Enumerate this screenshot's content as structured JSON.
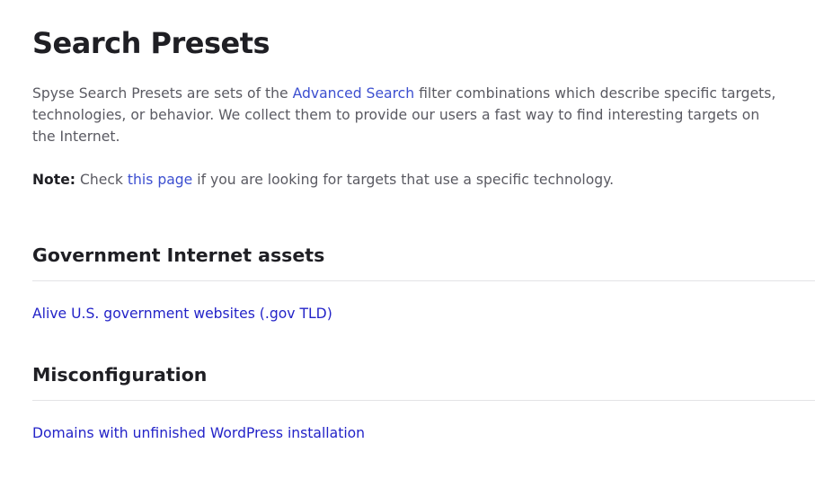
{
  "page": {
    "title": "Search Presets"
  },
  "intro": {
    "text_before_link": "Spyse Search Presets are sets of the ",
    "link_label": "Advanced Search",
    "text_after_link": " filter combinations which describe specific targets, technologies, or behavior. We collect them to provide our users a fast way to find interesting targets on the Internet."
  },
  "note": {
    "label": "Note:",
    "text_before_link": " Check ",
    "link_label": "this page",
    "text_after_link": " if you are looking for targets that use a specific technology."
  },
  "sections": [
    {
      "heading": "Government Internet assets",
      "presets": [
        {
          "label": "Alive U.S. government websites (.gov TLD)"
        }
      ]
    },
    {
      "heading": "Misconfiguration",
      "presets": [
        {
          "label": "Domains with unfinished WordPress installation"
        }
      ]
    }
  ],
  "colors": {
    "heading": "#1f1f24",
    "body_text": "#5a5a62",
    "inline_link": "#3c4fd0",
    "preset_link": "#2323c8",
    "divider": "#e3e3e6"
  }
}
